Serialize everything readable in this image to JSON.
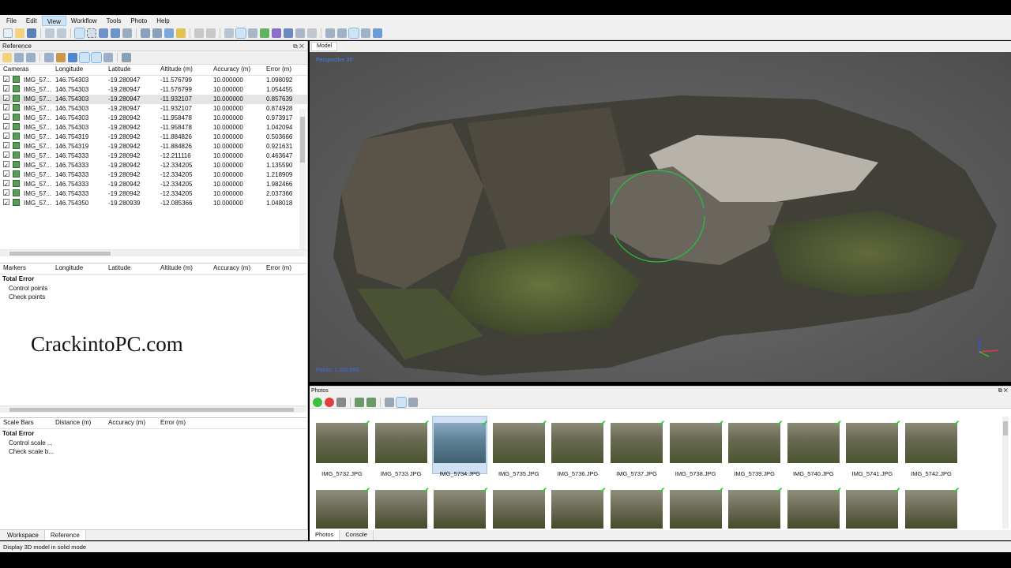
{
  "menu": [
    "File",
    "Edit",
    "View",
    "Workflow",
    "Tools",
    "Photo",
    "Help"
  ],
  "menu_active": "View",
  "reference_panel": {
    "title": "Reference",
    "cameras": {
      "headers": [
        "Cameras",
        "Longitude",
        "Latitude",
        "Altitude (m)",
        "Accuracy (m)",
        "Error (m)"
      ],
      "rows": [
        [
          "IMG_57...",
          "146.754303",
          "-19.280947",
          "-11.576799",
          "10.000000",
          "1.098092"
        ],
        [
          "IMG_57...",
          "146.754303",
          "-19.280947",
          "-11.576799",
          "10.000000",
          "1.054455"
        ],
        [
          "IMG_57...",
          "146.754303",
          "-19.280947",
          "-11.932107",
          "10.000000",
          "0.857639"
        ],
        [
          "IMG_57...",
          "146.754303",
          "-19.280947",
          "-11.932107",
          "10.000000",
          "0.874928"
        ],
        [
          "IMG_57...",
          "146.754303",
          "-19.280942",
          "-11.958478",
          "10.000000",
          "0.973917"
        ],
        [
          "IMG_57...",
          "146.754303",
          "-19.280942",
          "-11.958478",
          "10.000000",
          "1.042094"
        ],
        [
          "IMG_57...",
          "146.754319",
          "-19.280942",
          "-11.884826",
          "10.000000",
          "0.503666"
        ],
        [
          "IMG_57...",
          "146.754319",
          "-19.280942",
          "-11.884826",
          "10.000000",
          "0.921631"
        ],
        [
          "IMG_57...",
          "146.754333",
          "-19.280942",
          "-12.211116",
          "10.000000",
          "0.463647"
        ],
        [
          "IMG_57...",
          "146.754333",
          "-19.280942",
          "-12.334205",
          "10.000000",
          "1.135590"
        ],
        [
          "IMG_57...",
          "146.754333",
          "-19.280942",
          "-12.334205",
          "10.000000",
          "1.218909"
        ],
        [
          "IMG_57...",
          "146.754333",
          "-19.280942",
          "-12.334205",
          "10.000000",
          "1.982466"
        ],
        [
          "IMG_57...",
          "146.754333",
          "-19.280942",
          "-12.334205",
          "10.000000",
          "2.037366"
        ],
        [
          "IMG_57...",
          "146.754350",
          "-19.280939",
          "-12.085366",
          "10.000000",
          "1.048018"
        ]
      ]
    },
    "markers": {
      "headers": [
        "Markers",
        "Longitude",
        "Latitude",
        "Altitude (m)",
        "Accuracy (m)",
        "Error (m)"
      ],
      "total": "Total Error",
      "items": [
        "Control points",
        "Check points"
      ]
    },
    "scalebars": {
      "headers": [
        "Scale Bars",
        "Distance (m)",
        "Accuracy (m)",
        "Error (m)"
      ],
      "total": "Total Error",
      "items": [
        "Control scale ...",
        "Check scale b..."
      ]
    }
  },
  "watermark": "CrackintoPC.com",
  "left_tabs": [
    "Workspace",
    "Reference"
  ],
  "model": {
    "tab": "Model",
    "projection": "Perspective 30°",
    "points_label": "Points: 1,393,693"
  },
  "photos": {
    "title": "Photos",
    "row1": [
      "IMG_5732.JPG",
      "IMG_5733.JPG",
      "IMG_5734.JPG",
      "IMG_5735.JPG",
      "IMG_5736.JPG",
      "IMG_5737.JPG",
      "IMG_5738.JPG",
      "IMG_5739.JPG",
      "IMG_5740.JPG",
      "IMG_5741.JPG",
      "IMG_5742.JPG"
    ],
    "selected": "IMG_5734.JPG",
    "tabs": [
      "Photos",
      "Console"
    ]
  },
  "status": "Display 3D model in solid mode",
  "colors": {
    "accent": "#4a7cf0",
    "check": "#3fbf3f",
    "selection": "#cfe1f3"
  }
}
